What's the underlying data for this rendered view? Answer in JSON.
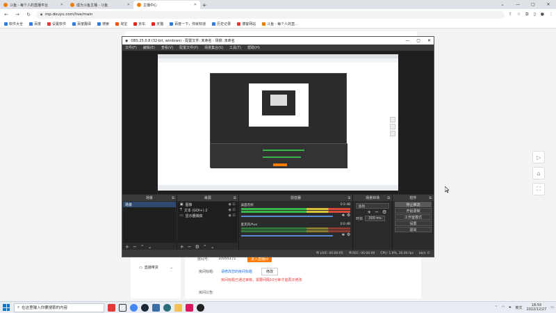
{
  "browser": {
    "tabs": [
      {
        "title": "斗鱼 - 每个人的直播平台",
        "active": false
      },
      {
        "title": "成为斗鱼主播 - 斗鱼",
        "active": false
      },
      {
        "title": "主播中心",
        "active": true
      }
    ],
    "new_tab": "+",
    "url": "mp.douyu.com/live/main",
    "bookmarks": [
      "软件大全",
      "百度",
      "设置软件",
      "百度翻译",
      "搜索",
      "淘宝",
      "京东",
      "天猫",
      "百度一下，你就知道",
      "历史记录",
      "博客网站",
      "斗鱼 - 每个人的直..."
    ]
  },
  "page": {
    "room_id_label": "房间号:",
    "room_id_value": "10055171",
    "start_live_button": "进入直播间",
    "category_label": "房间标题:",
    "category_link": "请修改您的房间标题",
    "modify_button": "修改",
    "warning": "房间标题已通过审核，需要间隔10分钟才能再次修改",
    "announcement_label": "房间公告:",
    "sidebar_item": "直播带货",
    "side_tools": [
      "play",
      "home",
      "fullscreen"
    ]
  },
  "obs": {
    "title": "OBS 25.0.8 (32-bit, windows) - 配置文件: 未命名 - 场景: 未命名",
    "menu": [
      "文件(F)",
      "编辑(E)",
      "查看(V)",
      "配置文件(P)",
      "场景集合(S)",
      "工具(T)",
      "帮助(H)"
    ],
    "docks": {
      "scenes": {
        "title": "场景",
        "items": [
          "场景"
        ]
      },
      "sources": {
        "title": "来源",
        "items": [
          {
            "icon": "image-icon",
            "name": "图像"
          },
          {
            "icon": "text-icon",
            "name": "文本 (GDI+) 2"
          },
          {
            "icon": "monitor-icon",
            "name": "显示器捕获"
          }
        ]
      },
      "mixer": {
        "title": "混音器",
        "channels": [
          {
            "name": "桌面音频",
            "db": "0.0 dB"
          },
          {
            "name": "麦克风/Aux",
            "db": "0.0 dB"
          }
        ]
      },
      "transitions": {
        "title": "场景转场",
        "type": "淡出",
        "duration_label": "时长",
        "duration_value": "300 ms"
      },
      "controls": {
        "title": "控件",
        "buttons": [
          "停止推流",
          "开始录制",
          "工作室模式",
          "设置",
          "退出"
        ]
      }
    },
    "status": {
      "live": "LIVE: 00:00:05",
      "rec": "REC: 00:00:00",
      "cpu": "CPU: 1.9%, 30.00 fps",
      "kbps": "kb/s: 0"
    }
  },
  "taskbar": {
    "search_placeholder": "在这里输入你要搜索的内容",
    "lang": "英文",
    "time": "18:59",
    "date": "2022/12/27"
  }
}
